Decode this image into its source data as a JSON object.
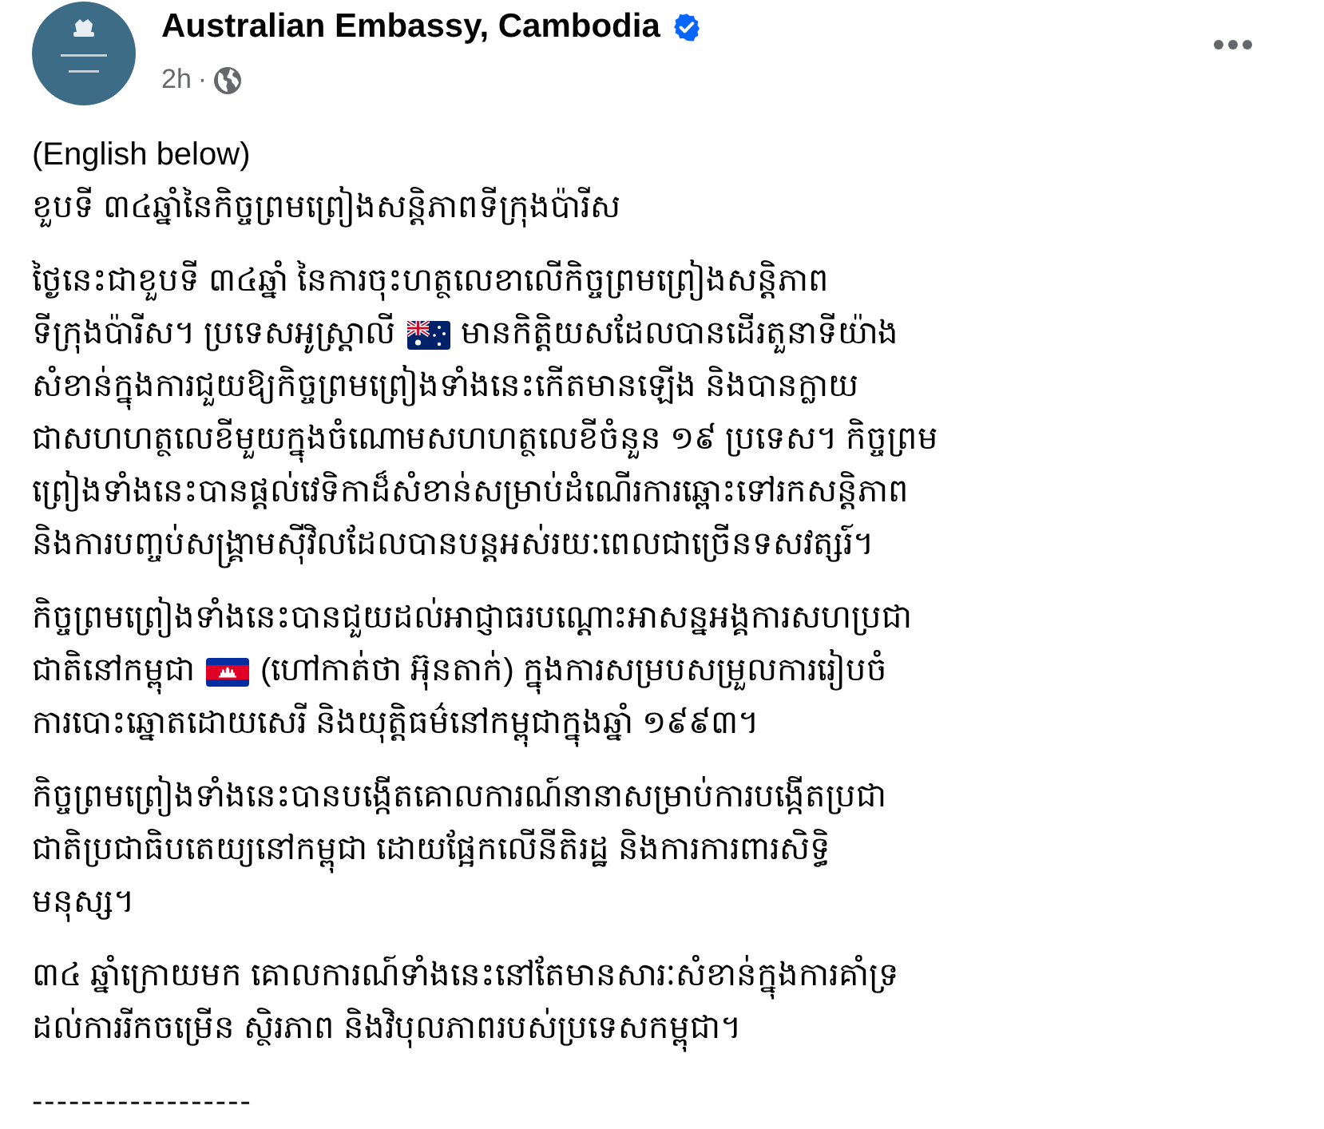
{
  "post": {
    "author": {
      "name": "Australian Embassy, Cambodia",
      "verified": true
    },
    "time": "2h",
    "separator": "·",
    "body": {
      "intro": "(English below)",
      "heading": "ខួបទី ៣៤ឆ្នាំនៃកិច្ចព្រមព្រៀងសន្តិភាពទីក្រុងប៉ារីស",
      "paragraphs": [
        {
          "lines": [
            [
              {
                "kind": "text",
                "text": "ថ្ងៃនេះជាខួបទី ៣៤ឆ្នាំ នៃការចុះហត្ថលេខាលើកិច្ចព្រមព្រៀងសន្តិភាព"
              }
            ],
            [
              {
                "kind": "text",
                "text": "ទីក្រុងប៉ារីស។ ប្រទេសអូស្ត្រាលី"
              },
              {
                "kind": "flag_au"
              },
              {
                "kind": "text",
                "text": "មានកិត្តិយសដែលបានដើរតួនាទីយ៉ាង"
              }
            ],
            [
              {
                "kind": "text",
                "text": "សំខាន់ក្នុងការជួយឱ្យកិច្ចព្រមព្រៀងទាំងនេះកើតមានឡើង និងបានក្លាយ"
              }
            ],
            [
              {
                "kind": "text",
                "text": "ជាសហហត្ថលេខីមួយក្នុងចំណោមសហហត្ថលេខីចំនួន ១៩ ប្រទេស។ កិច្ចព្រម"
              }
            ],
            [
              {
                "kind": "text",
                "text": "ព្រៀងទាំងនេះបានផ្តល់វេទិកាដ៏សំខាន់សម្រាប់ដំណើរការឆ្ពោះទៅរកសន្តិភាព"
              }
            ],
            [
              {
                "kind": "text",
                "text": "និងការបញ្ចប់សង្គ្រាមស៊ីវិលដែលបានបន្តអស់រយៈពេលជាច្រើនទសវត្សរ៍។"
              }
            ]
          ]
        },
        {
          "lines": [
            [
              {
                "kind": "text",
                "text": "កិច្ចព្រមព្រៀងទាំងនេះបានជួយដល់អាជ្ញាធរបណ្តោះអាសន្នអង្គការសហប្រជា"
              }
            ],
            [
              {
                "kind": "text",
                "text": "ជាតិនៅកម្ពុជា"
              },
              {
                "kind": "flag_kh"
              },
              {
                "kind": "text",
                "text": "(ហៅកាត់ថា អ៊ុនតាក់) ក្នុងការសម្របសម្រួលការរៀបចំ"
              }
            ],
            [
              {
                "kind": "text",
                "text": "ការបោះឆ្នោតដោយសេរី និងយុត្តិធម៌នៅកម្ពុជាក្នុងឆ្នាំ ១៩៩៣។"
              }
            ]
          ]
        },
        {
          "lines": [
            [
              {
                "kind": "text",
                "text": "កិច្ចព្រមព្រៀងទាំងនេះបានបង្កើតគោលការណ៍នានាសម្រាប់ការបង្កើតប្រជា"
              }
            ],
            [
              {
                "kind": "text",
                "text": "ជាតិប្រជាធិបតេយ្យនៅកម្ពុជា ដោយផ្អែកលើនីតិរដ្ឋ និងការការពារសិទ្ធិ"
              }
            ],
            [
              {
                "kind": "text",
                "text": "មនុស្ស។"
              }
            ]
          ]
        },
        {
          "lines": [
            [
              {
                "kind": "text",
                "text": "៣៤ ឆ្នាំក្រោយមក គោលការណ៍ទាំងនេះនៅតែមានសារៈសំខាន់ក្នុងការគាំទ្រ"
              }
            ],
            [
              {
                "kind": "text",
                "text": "ដល់ការរីកចម្រើន ស្ថិរភាព និងវិបុលភាពរបស់ប្រទេសកម្ពុជា។"
              }
            ]
          ]
        }
      ],
      "divider": "------------------"
    }
  }
}
